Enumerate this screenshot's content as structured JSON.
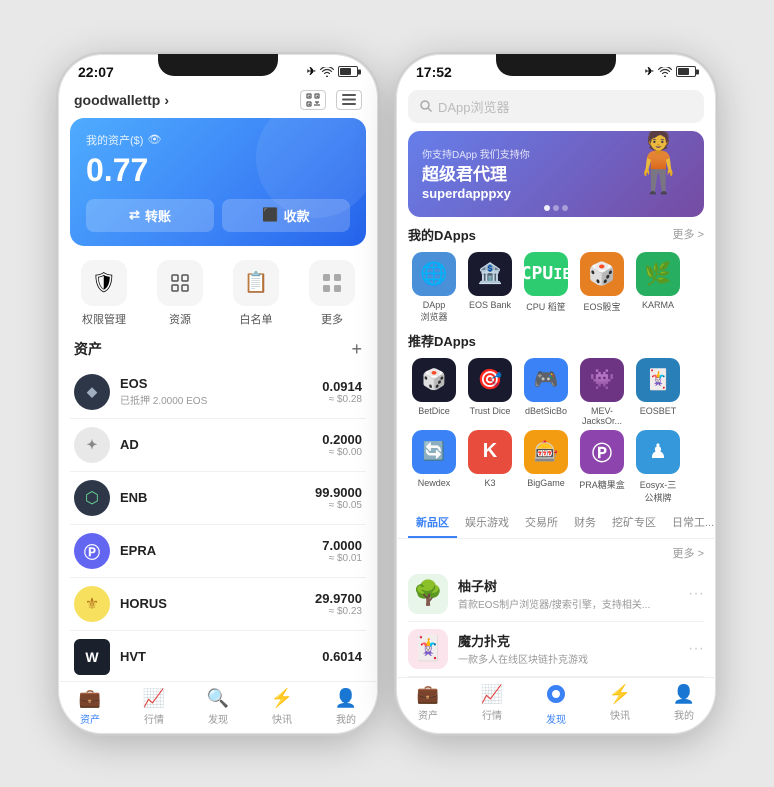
{
  "phone1": {
    "status": {
      "time": "22:07",
      "airplane": "✈",
      "wifi": "wifi",
      "battery": "battery"
    },
    "header": {
      "wallet_name": "goodwallettp",
      "chevron": "›",
      "icon1": "⊞",
      "icon2": "⬜"
    },
    "balance_card": {
      "label": "我的资产($)",
      "eye_icon": "👁",
      "amount": "0.77",
      "btn_transfer": "转账",
      "btn_transfer_icon": "↔",
      "btn_receive": "收款",
      "btn_receive_icon": "⬛"
    },
    "quick_actions": [
      {
        "icon": "🛡",
        "label": "权限管理"
      },
      {
        "icon": "⚙",
        "label": "资源"
      },
      {
        "icon": "📋",
        "label": "白名单"
      },
      {
        "icon": "⊞",
        "label": "更多"
      }
    ],
    "assets_title": "资产",
    "assets_add": "+",
    "assets": [
      {
        "icon": "◆",
        "name": "EOS",
        "sub": "已抵押 2.0000 EOS",
        "amount": "0.0914",
        "usd": "≈ $0.28",
        "color": "#2d3748"
      },
      {
        "icon": "✦",
        "name": "AD",
        "sub": "",
        "amount": "0.2000",
        "usd": "≈ $0.00",
        "color": "#718096"
      },
      {
        "icon": "⬡",
        "name": "ENB",
        "sub": "",
        "amount": "99.9000",
        "usd": "≈ $0.05",
        "color": "#2d3748"
      },
      {
        "icon": "Ⓟ",
        "name": "EPRA",
        "sub": "",
        "amount": "7.0000",
        "usd": "≈ $0.01",
        "color": "#6366f1"
      },
      {
        "icon": "⚜",
        "name": "HORUS",
        "sub": "",
        "amount": "29.9700",
        "usd": "≈ $0.23",
        "color": "#d97706"
      },
      {
        "icon": "W",
        "name": "HVT",
        "sub": "",
        "amount": "0.6014",
        "usd": "",
        "color": "#1a202c"
      }
    ],
    "nav": [
      {
        "icon": "💼",
        "label": "资产",
        "active": true
      },
      {
        "icon": "📈",
        "label": "行情",
        "active": false
      },
      {
        "icon": "🔍",
        "label": "发现",
        "active": false
      },
      {
        "icon": "⚡",
        "label": "快讯",
        "active": false
      },
      {
        "icon": "👤",
        "label": "我的",
        "active": false
      }
    ]
  },
  "phone2": {
    "status": {
      "time": "17:52",
      "airplane": "✈",
      "wifi": "wifi",
      "battery": "battery"
    },
    "search_placeholder": "DApp浏览器",
    "banner": {
      "sub": "你支持DApp 我们支持你",
      "title_line1": "超级君代理",
      "title_line2": "superdapppxy",
      "dots": [
        "●",
        "○",
        "○"
      ]
    },
    "my_dapps_title": "我的DApps",
    "my_dapps_more": "更多 >",
    "my_dapps": [
      {
        "name": "DApp\n浏览器",
        "bg": "#4a90d9",
        "icon": "🌐"
      },
      {
        "name": "EOS Bank",
        "bg": "#1a1a2e",
        "icon": "🏦"
      },
      {
        "name": "CPU 稻筐",
        "bg": "#2ecc71",
        "icon": "💻"
      },
      {
        "name": "EOS骰宝",
        "bg": "#e67e22",
        "icon": "🎲"
      },
      {
        "name": "KARMA",
        "bg": "#27ae60",
        "icon": "🌿"
      }
    ],
    "rec_dapps_title": "推荐DApps",
    "rec_dapps": [
      {
        "name": "BetDice",
        "bg": "#1a1a2e",
        "icon": "🎲"
      },
      {
        "name": "Trust Dice",
        "bg": "#1a1a2e",
        "icon": "🎯"
      },
      {
        "name": "dBetSicBo",
        "bg": "#3b82f6",
        "icon": "🎮"
      },
      {
        "name": "MEV-\nJacksOr...",
        "bg": "#6c3483",
        "icon": "👾"
      },
      {
        "name": "EOSBET",
        "bg": "#2980b9",
        "icon": "🃏"
      },
      {
        "name": "Newdex",
        "bg": "#3b82f6",
        "icon": "🔄"
      },
      {
        "name": "K3",
        "bg": "#e74c3c",
        "icon": "K"
      },
      {
        "name": "BigGame",
        "bg": "#f39c12",
        "icon": "🎰"
      },
      {
        "name": "PRA糖果盒",
        "bg": "#8e44ad",
        "icon": "Ⓟ"
      },
      {
        "name": "Eosyx-三\n公棋牌",
        "bg": "#3498db",
        "icon": "♟"
      }
    ],
    "tabs": [
      {
        "label": "新品区",
        "active": true
      },
      {
        "label": "娱乐游戏",
        "active": false
      },
      {
        "label": "交易所",
        "active": false
      },
      {
        "label": "财务",
        "active": false
      },
      {
        "label": "挖矿专区",
        "active": false
      },
      {
        "label": "日常工...",
        "active": false
      }
    ],
    "new_apps_more": "更多 >",
    "new_apps": [
      {
        "name": "柚子树",
        "desc": "首款EOS制户浏览器/搜索引擎，支持相关...",
        "icon": "🌳",
        "bg": "#f0f4f0"
      },
      {
        "name": "魔力扑克",
        "desc": "一款多人在线区块链扑克游戏",
        "icon": "🃏",
        "bg": "#fff0f0"
      }
    ],
    "nav": [
      {
        "icon": "💼",
        "label": "资产",
        "active": false
      },
      {
        "icon": "📈",
        "label": "行情",
        "active": false
      },
      {
        "icon": "🔍",
        "label": "发现",
        "active": true
      },
      {
        "icon": "⚡",
        "label": "快讯",
        "active": false
      },
      {
        "icon": "👤",
        "label": "我的",
        "active": false
      }
    ]
  }
}
